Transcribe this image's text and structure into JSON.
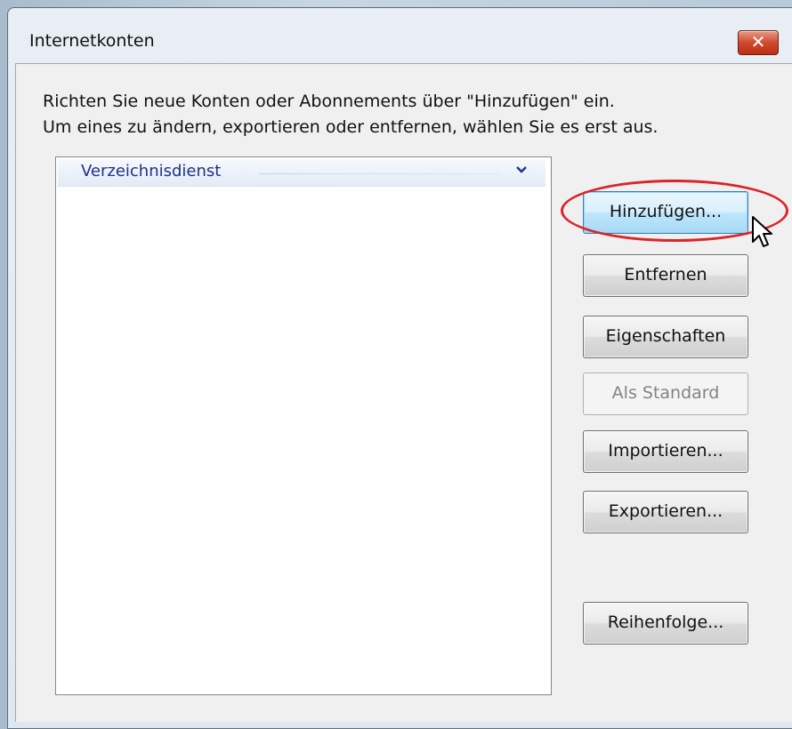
{
  "window": {
    "title": "Internetkonten",
    "close_label": "✕"
  },
  "instructions": {
    "line1": "Richten Sie neue Konten oder Abonnements über \"Hinzufügen\" ein.",
    "line2": "Um eines zu ändern, exportieren oder entfernen, wählen Sie es erst aus."
  },
  "list": {
    "group_label": "Verzeichnisdienst",
    "chevron": "⌄"
  },
  "buttons": {
    "add": "Hinzufügen...",
    "remove": "Entfernen",
    "properties": "Eigenschaften",
    "set_default": "Als Standard",
    "import": "Importieren...",
    "export": "Exportieren...",
    "order": "Reihenfolge..."
  },
  "colors": {
    "highlight": "#d9262b",
    "group_text": "#1e3287"
  },
  "icons": {
    "close": "close-icon",
    "chevron": "chevron-down-icon",
    "cursor": "mouse-pointer-icon"
  }
}
